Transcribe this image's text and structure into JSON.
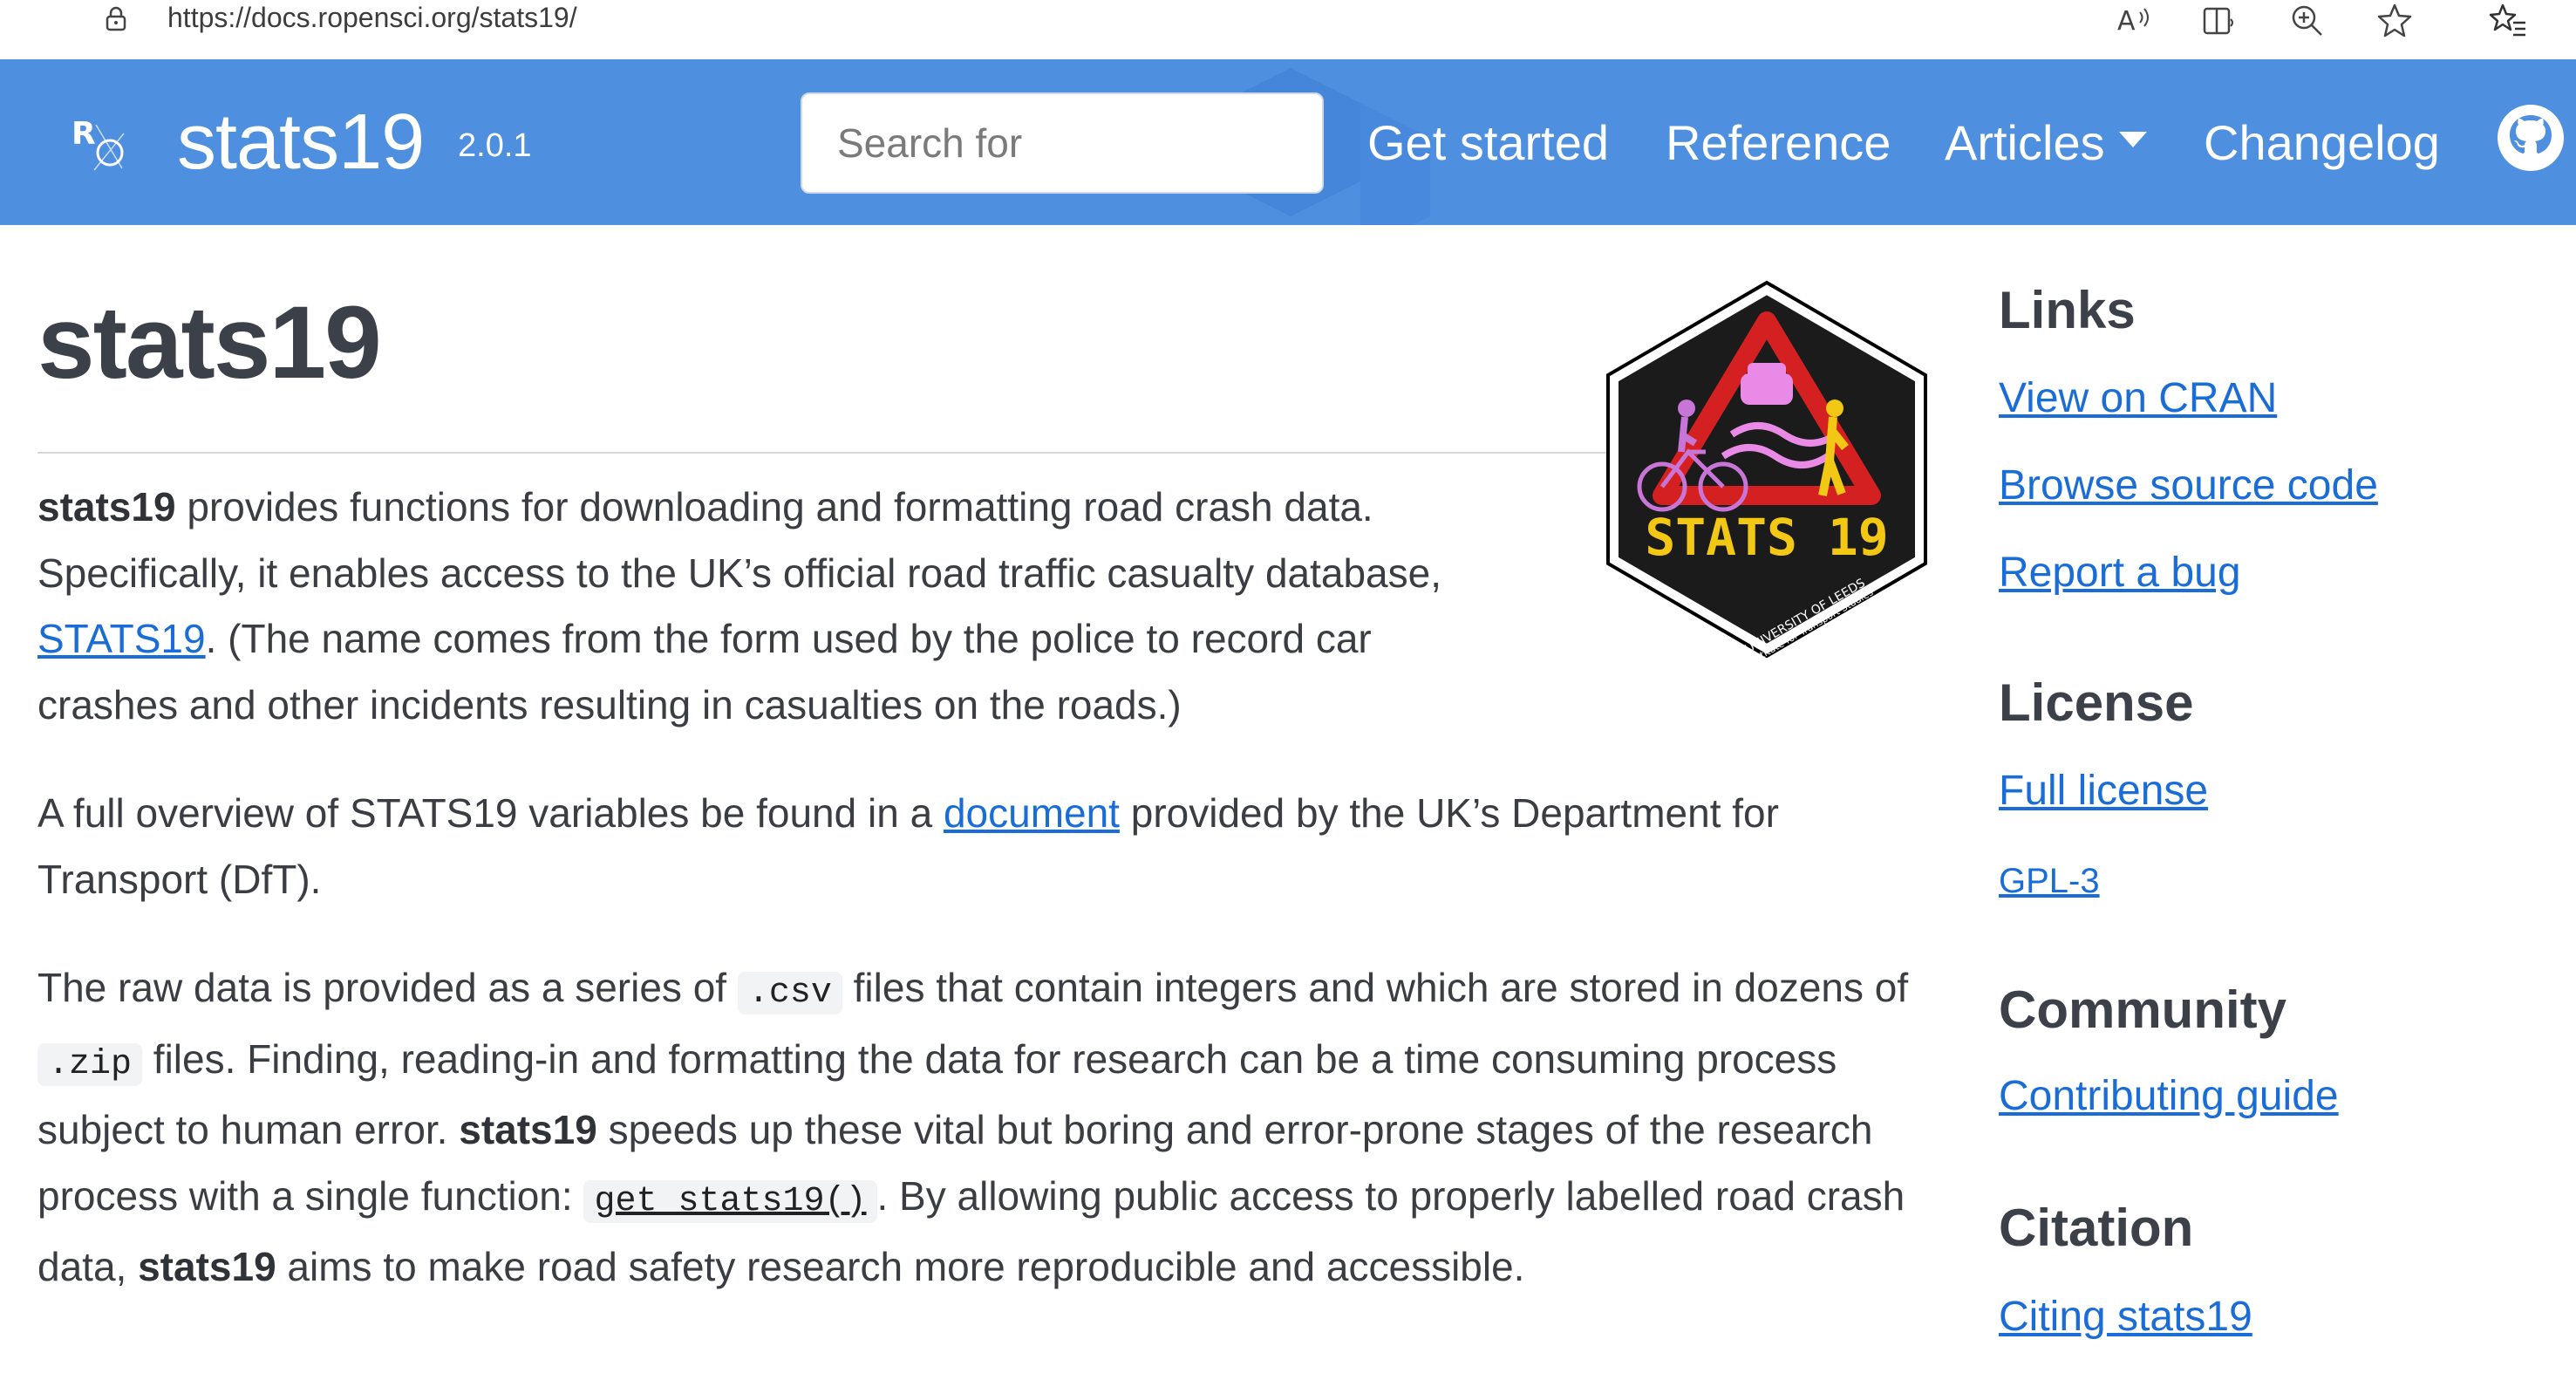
{
  "browser": {
    "url": "https://docs.ropensci.org/stats19/",
    "icons": [
      "lock-icon",
      "read-aloud-icon",
      "reader-view-icon",
      "zoom-icon",
      "favorite-star-icon",
      "favorites-list-icon"
    ]
  },
  "navbar": {
    "brand": "stats19",
    "version": "2.0.1",
    "search_placeholder": "Search for",
    "links": {
      "get_started": "Get started",
      "reference": "Reference",
      "articles": "Articles",
      "changelog": "Changelog"
    },
    "accent_color": "#4f8fe0"
  },
  "main": {
    "title": "stats19",
    "logo_text": "STATS 19",
    "logo_sub": "UNIVERSITY OF LEEDS",
    "logo_sub2": "Institute for Transport Studies",
    "p1": {
      "bold": "stats19",
      "t1": " provides functions for downloading and formatting road crash data. Specifically, it enables access to the UK’s official road traffic casualty database, ",
      "link": "STATS19",
      "t2": ". (The name comes from the form used by the police to record car crashes and other incidents resulting in casualties on the roads.)"
    },
    "p2": {
      "t1": "A full overview of STATS19 variables be found in a ",
      "link": "document",
      "t2": " provided by the UK’s Department for Transport (DfT)."
    },
    "p3": {
      "t1": "The raw data is provided as a series of ",
      "code1": ".csv",
      "t2": " files that contain integers and which are stored in dozens of ",
      "code2": ".zip",
      "t3": " files. Finding, reading-in and formatting the data for research can be a time consuming process subject to human error. ",
      "bold1": "stats19",
      "t4": " speeds up these vital but boring and error-prone stages of the research process with a single function: ",
      "code3": "get_stats19()",
      "t5": ". By allowing public access to properly labelled road crash data, ",
      "bold2": "stats19",
      "t6": " aims to make road safety research more reproducible and accessible."
    }
  },
  "sidebar": {
    "links_heading": "Links",
    "view_cran": "View on CRAN",
    "browse_source": "Browse source code",
    "report_bug": "Report a bug",
    "license_heading": "License",
    "full_license": "Full license",
    "gpl": "GPL-3",
    "community_heading": "Community",
    "contributing": "Contributing guide",
    "citation_heading": "Citation",
    "citing": "Citing stats19"
  }
}
